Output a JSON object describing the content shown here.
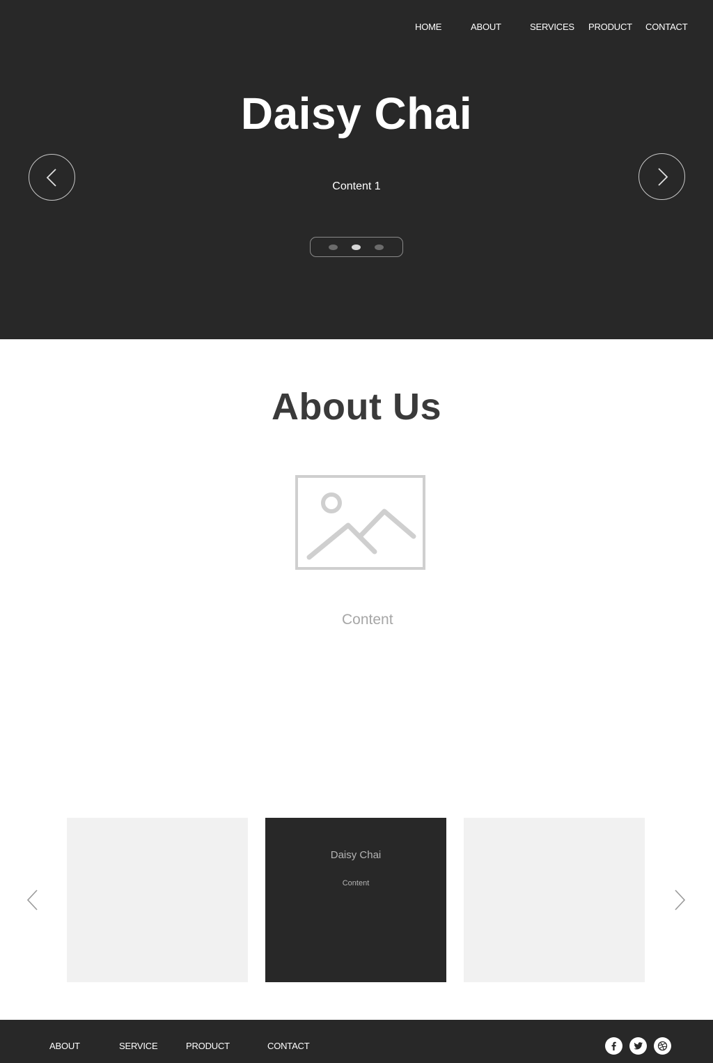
{
  "nav": {
    "items": [
      {
        "label": "HOME"
      },
      {
        "label": "ABOUT"
      },
      {
        "label": "SERVICES"
      },
      {
        "label": "PRODUCT"
      },
      {
        "label": "CONTACT"
      }
    ]
  },
  "hero": {
    "title": "Daisy Chai",
    "content": "Content 1",
    "prev_icon": "chevron-left-icon",
    "next_icon": "chevron-right-icon",
    "slides_total": 3,
    "active_slide": 2
  },
  "about": {
    "title": "About Us",
    "image_icon": "image-placeholder-icon",
    "content": "Content"
  },
  "cards": {
    "items": [
      {
        "title": "",
        "content": ""
      },
      {
        "title": "Daisy Chai",
        "content": "Content"
      },
      {
        "title": "",
        "content": ""
      }
    ],
    "active_card": 2,
    "prev_icon": "chevron-left-icon",
    "next_icon": "chevron-right-icon"
  },
  "footer": {
    "items": [
      {
        "label": "ABOUT"
      },
      {
        "label": "SERVICE"
      },
      {
        "label": "PRODUCT"
      },
      {
        "label": "CONTACT"
      }
    ],
    "social": [
      {
        "icon": "facebook-icon"
      },
      {
        "icon": "twitter-icon"
      },
      {
        "icon": "dribbble-icon"
      }
    ]
  },
  "colors": {
    "dark_background": "#282828",
    "card_light": "#f1f1f1",
    "text_muted": "#a6a6a6"
  }
}
